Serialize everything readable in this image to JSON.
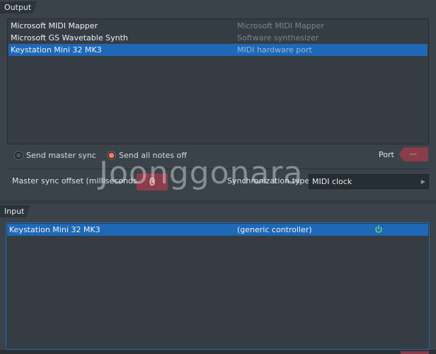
{
  "output": {
    "title": "Output",
    "devices": [
      {
        "name": "Microsoft MIDI Mapper",
        "type": "Microsoft MIDI Mapper",
        "selected": false
      },
      {
        "name": "Microsoft GS Wavetable Synth",
        "type": "Software synthesizer",
        "selected": false
      },
      {
        "name": "Keystation Mini 32 MK3",
        "type": "MIDI hardware port",
        "selected": true
      }
    ],
    "send_master_sync_label": "Send master sync",
    "send_master_sync_checked": false,
    "send_all_notes_off_label": "Send all notes off",
    "send_all_notes_off_checked": true,
    "port_label": "Port",
    "port_value": "---",
    "master_sync_offset_label": "Master sync offset (milliseconds)",
    "master_sync_offset_value": "0",
    "sync_type_label": "Synchronization type",
    "sync_type_value": "MIDI clock"
  },
  "input": {
    "title": "Input",
    "devices": [
      {
        "name": "Keystation Mini 32 MK3",
        "type": "(generic controller)",
        "enabled": true,
        "selected": true
      }
    ]
  },
  "watermark": "Joonggonara",
  "colors": {
    "accent_blue": "#1f68b6",
    "port_red": "#8a3c48",
    "radio_on": "#ff7a55",
    "power_green": "#6fe07a"
  }
}
